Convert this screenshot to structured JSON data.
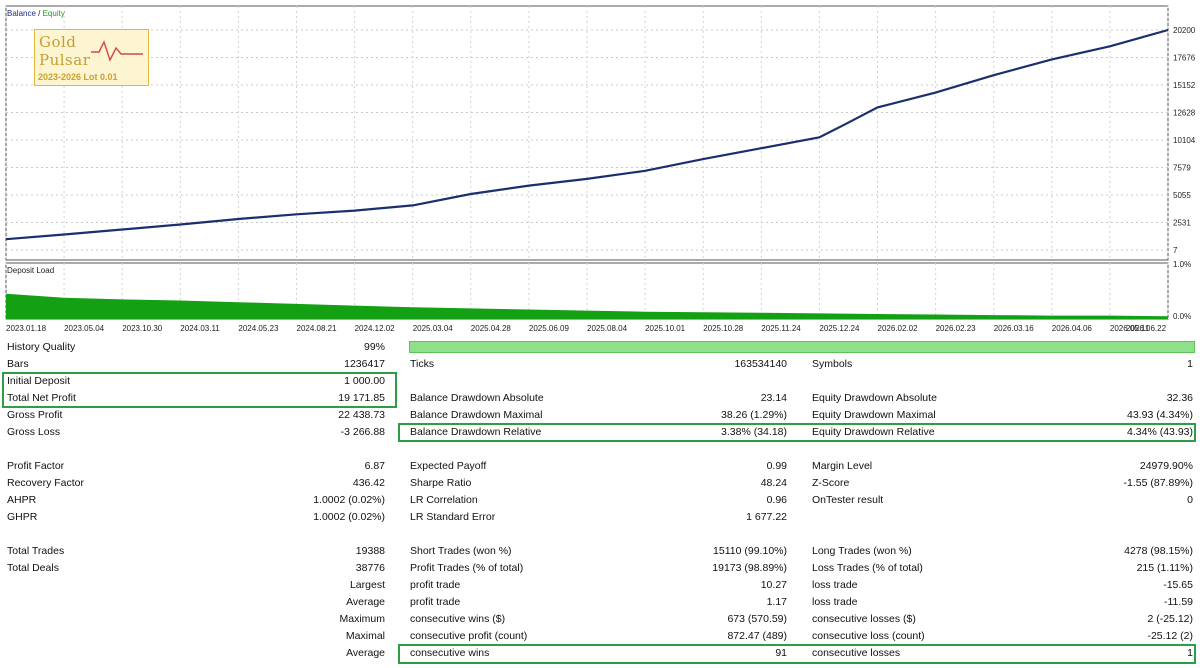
{
  "chart": {
    "legend_balance": "Balance",
    "legend_separator": " / ",
    "legend_equity": "Equity",
    "deposit_title": "Deposit Load",
    "y_ticks": [
      "20200",
      "17676",
      "15152",
      "12628",
      "10104",
      "7579",
      "5055",
      "2531",
      "7"
    ],
    "deposit_ticks": [
      "1.0%",
      "0.0%"
    ],
    "dates": [
      "2023.01.18",
      "2023.05.04",
      "2023.10.30",
      "2024.03.11",
      "2024.05.23",
      "2024.08.21",
      "2024.12.02",
      "2025.03.04",
      "2025.04.28",
      "2025.06.09",
      "2025.08.04",
      "2025.10.01",
      "2025.10.28",
      "2025.11.24",
      "2025.12.24",
      "2026.02.02",
      "2026.02.23",
      "2026.03.16",
      "2026.04.06",
      "2026.05.11",
      "2026.06.22"
    ],
    "line_color": "#1b2f6e",
    "fill_color": "#13a013"
  },
  "chart_data": {
    "type": "line",
    "title": "",
    "series": [
      {
        "name": "Balance",
        "x": [
          "2023.01.18",
          "2023.05.04",
          "2023.10.30",
          "2024.03.11",
          "2024.05.23",
          "2024.08.21",
          "2024.12.02",
          "2025.03.04",
          "2025.04.28",
          "2025.06.09",
          "2025.08.04",
          "2025.10.01",
          "2025.10.28",
          "2025.11.24",
          "2025.12.24",
          "2026.01.10",
          "2026.02.02",
          "2026.02.23",
          "2026.03.16",
          "2026.04.06",
          "2026.05.11",
          "2026.06.22"
        ],
        "values": [
          1000,
          1430,
          1890,
          2350,
          2850,
          3280,
          3620,
          4100,
          5150,
          5920,
          6530,
          7280,
          8350,
          9350,
          10350,
          11500,
          13100,
          14450,
          16050,
          17500,
          18700,
          20200
        ]
      }
    ],
    "ylim": [
      7,
      20200
    ],
    "deposit_load": {
      "x": [
        "2023.01.18",
        "2023.05.04",
        "2023.10.30",
        "2024.03.11",
        "2024.05.23",
        "2024.08.21",
        "2024.12.02",
        "2025.03.04",
        "2025.04.28",
        "2025.06.09",
        "2025.08.04",
        "2025.10.01",
        "2025.10.28",
        "2025.11.24",
        "2025.12.24",
        "2026.02.02",
        "2026.02.23",
        "2026.03.16",
        "2026.04.06",
        "2026.05.11",
        "2026.06.22"
      ],
      "values": [
        0.45,
        0.38,
        0.35,
        0.33,
        0.3,
        0.27,
        0.24,
        0.21,
        0.19,
        0.17,
        0.15,
        0.13,
        0.12,
        0.11,
        0.1,
        0.09,
        0.08,
        0.07,
        0.06,
        0.06,
        0.05
      ],
      "ylim": [
        0,
        1.0
      ]
    }
  },
  "logo": {
    "line1": "Gold",
    "line2": "Pulsar",
    "line3": "2023-2026 Lot 0.01"
  },
  "report": {
    "history_quality": {
      "label": "History Quality",
      "value": "99%"
    },
    "bars": {
      "label": "Bars",
      "value": "1236417"
    },
    "ticks": {
      "label": "Ticks",
      "value": "163534140"
    },
    "symbols": {
      "label": "Symbols",
      "value": "1"
    },
    "initial_deposit": {
      "label": "Initial Deposit",
      "value": "1 000.00"
    },
    "total_net_profit": {
      "label": "Total Net Profit",
      "value": "19 171.85"
    },
    "gross_profit": {
      "label": "Gross Profit",
      "value": "22 438.73"
    },
    "gross_loss": {
      "label": "Gross Loss",
      "value": "-3 266.88"
    },
    "balance_dd_abs": {
      "label": "Balance Drawdown Absolute",
      "value": "23.14"
    },
    "balance_dd_max": {
      "label": "Balance Drawdown Maximal",
      "value": "38.26 (1.29%)"
    },
    "balance_dd_rel": {
      "label": "Balance Drawdown Relative",
      "value": "3.38% (34.18)"
    },
    "equity_dd_abs": {
      "label": "Equity Drawdown Absolute",
      "value": "32.36"
    },
    "equity_dd_max": {
      "label": "Equity Drawdown Maximal",
      "value": "43.93 (4.34%)"
    },
    "equity_dd_rel": {
      "label": "Equity Drawdown Relative",
      "value": "4.34% (43.93)"
    },
    "profit_factor": {
      "label": "Profit Factor",
      "value": "6.87"
    },
    "recovery_factor": {
      "label": "Recovery Factor",
      "value": "436.42"
    },
    "ahpr": {
      "label": "AHPR",
      "value": "1.0002 (0.02%)"
    },
    "ghpr": {
      "label": "GHPR",
      "value": "1.0002 (0.02%)"
    },
    "expected_payoff": {
      "label": "Expected Payoff",
      "value": "0.99"
    },
    "sharpe_ratio": {
      "label": "Sharpe Ratio",
      "value": "48.24"
    },
    "lr_correlation": {
      "label": "LR Correlation",
      "value": "0.96"
    },
    "lr_std_error": {
      "label": "LR Standard Error",
      "value": "1 677.22"
    },
    "margin_level": {
      "label": "Margin Level",
      "value": "24979.90%"
    },
    "z_score": {
      "label": "Z-Score",
      "value": "-1.55 (87.89%)"
    },
    "ontester": {
      "label": "OnTester result",
      "value": "0"
    },
    "total_trades": {
      "label": "Total Trades",
      "value": "19388"
    },
    "total_deals": {
      "label": "Total Deals",
      "value": "38776"
    },
    "short_trades": {
      "label": "Short Trades (won %)",
      "value": "15110 (99.10%)"
    },
    "profit_trades": {
      "label": "Profit Trades (% of total)",
      "value": "19173 (98.89%)"
    },
    "long_trades": {
      "label": "Long Trades (won %)",
      "value": "4278 (98.15%)"
    },
    "loss_trades": {
      "label": "Loss Trades (% of total)",
      "value": "215 (1.11%)"
    },
    "largest": {
      "label": "Largest",
      "mid": "profit trade",
      "mid_value": "10.27",
      "right": "loss trade",
      "right_value": "-15.65"
    },
    "average": {
      "label": "Average",
      "mid": "profit trade",
      "mid_value": "1.17",
      "right": "loss trade",
      "right_value": "-11.59"
    },
    "maximum": {
      "label": "Maximum",
      "mid": "consecutive wins ($)",
      "mid_value": "673 (570.59)",
      "right": "consecutive losses ($)",
      "right_value": "2 (-25.12)"
    },
    "maximal": {
      "label": "Maximal",
      "mid": "consecutive profit (count)",
      "mid_value": "872.47 (489)",
      "right": "consecutive loss (count)",
      "right_value": "-25.12 (2)"
    },
    "average2": {
      "label": "Average",
      "mid": "consecutive wins",
      "mid_value": "91",
      "right": "consecutive losses",
      "right_value": "1"
    }
  }
}
